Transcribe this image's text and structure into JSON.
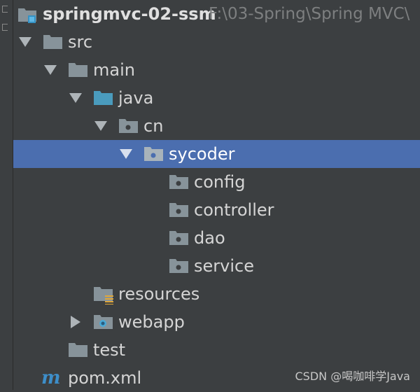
{
  "project": {
    "name": "springmvc-02-ssm",
    "path": "F:\\03-Spring\\Spring MVC\\"
  },
  "tree": {
    "src": "src",
    "main": "main",
    "java": "java",
    "cn": "cn",
    "sycoder": "sycoder",
    "config": "config",
    "controller": "controller",
    "dao": "dao",
    "service": "service",
    "resources": "resources",
    "webapp": "webapp",
    "test": "test",
    "pom": "pom.xml"
  },
  "colors": {
    "background": "#3c3f41",
    "selection": "#4b6eaf",
    "folder": "#87939a",
    "source_folder": "#4a9bbd",
    "maven": "#3d8ec9"
  },
  "watermark": "CSDN @喝咖啡学Java"
}
